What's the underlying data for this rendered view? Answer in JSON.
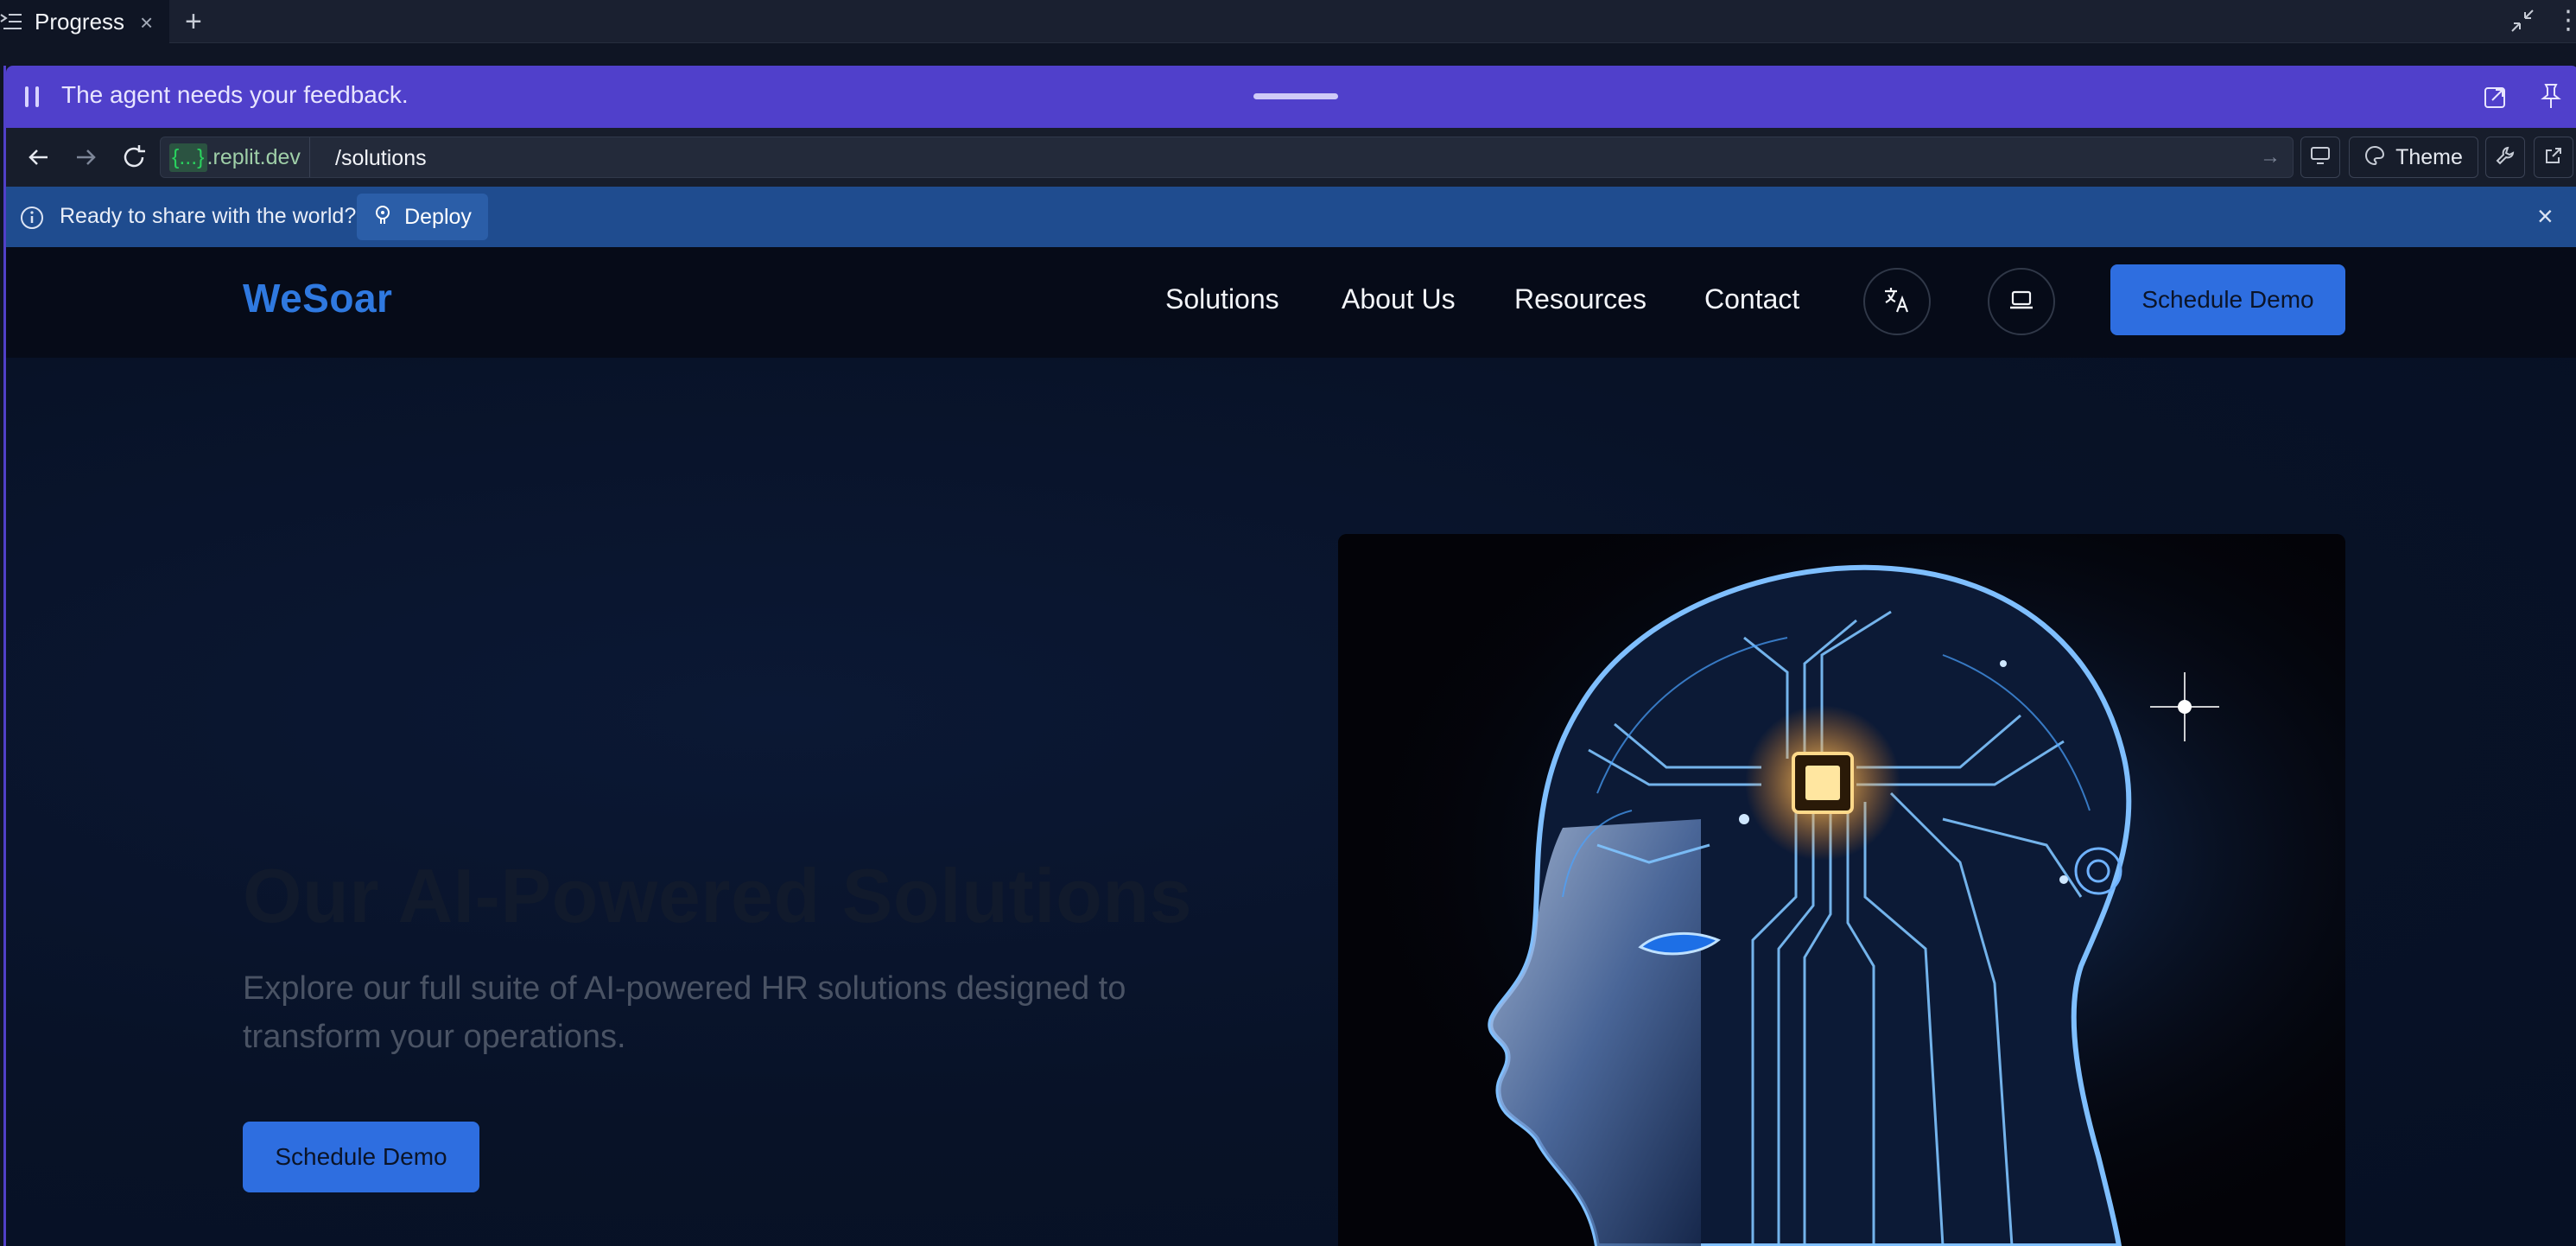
{
  "window": {
    "tab_label": "Progress",
    "tab_close": "×",
    "add_tab": "+",
    "more": "⋮"
  },
  "agent_bar": {
    "message": "The agent needs your feedback."
  },
  "address_bar": {
    "domain_brace": "{...}",
    "domain": ".replit.dev",
    "path": "/solutions",
    "go_icon": "→",
    "theme_label": "Theme"
  },
  "deploy_bar": {
    "message": "Ready to share with the world?",
    "button_label": "Deploy",
    "close": "×"
  },
  "site": {
    "logo": "WeSoar",
    "nav": [
      "Solutions",
      "About Us",
      "Resources",
      "Contact"
    ],
    "cta": "Schedule Demo"
  },
  "hero": {
    "title": "Our AI-Powered Solutions",
    "subtitle": "Explore our full suite of AI-powered HR solutions designed to transform your operations.",
    "cta": "Schedule Demo",
    "image_icon": "ai-head-illustration"
  },
  "colors": {
    "agent_bar": "#5040cb",
    "deploy_bar": "#1f4c8f",
    "brand_blue": "#2e6ee0",
    "logo": "#2f79e0"
  }
}
